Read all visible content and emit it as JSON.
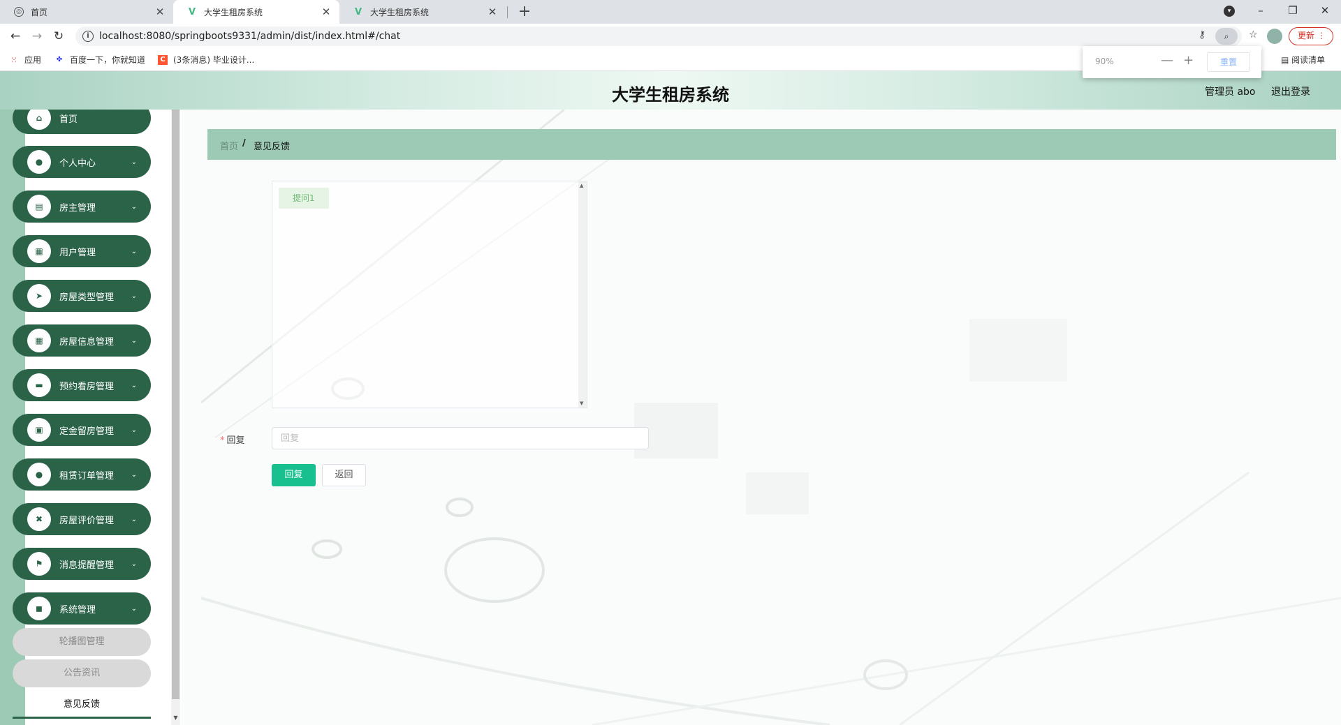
{
  "browser": {
    "tabs": [
      {
        "title": "首页"
      },
      {
        "title": "大学生租房系统"
      },
      {
        "title": "大学生租房系统"
      }
    ],
    "new_tab": "+",
    "url": "localhost:8080/springboots9331/admin/dist/index.html#/chat",
    "update_label": "更新",
    "window": {
      "minimize": "–",
      "restore": "❐",
      "close": "✕"
    },
    "bookmarks": [
      {
        "label": "应用"
      },
      {
        "label": "百度一下，你就知道"
      },
      {
        "label": "(3条消息) 毕业设计..."
      }
    ],
    "reading_list": "阅读清单",
    "zoom_popup": {
      "percent": "90%",
      "minus": "—",
      "plus": "+",
      "reset": "重置"
    }
  },
  "header": {
    "title": "大学生租房系统",
    "user": "管理员 abo",
    "logout": "退出登录"
  },
  "sidebar": {
    "items": [
      {
        "label": "首页",
        "icon": "home-icon",
        "glyph": "⌂",
        "expandable": false
      },
      {
        "label": "个人中心",
        "icon": "user-icon",
        "glyph": "●",
        "expandable": true
      },
      {
        "label": "房主管理",
        "icon": "clipboard-icon",
        "glyph": "▤",
        "expandable": true
      },
      {
        "label": "用户管理",
        "icon": "grid-icon",
        "glyph": "▦",
        "expandable": true
      },
      {
        "label": "房屋类型管理",
        "icon": "send-icon",
        "glyph": "➤",
        "expandable": true
      },
      {
        "label": "房屋信息管理",
        "icon": "grid-icon",
        "glyph": "▦",
        "expandable": true
      },
      {
        "label": "预约看房管理",
        "icon": "tag-icon",
        "glyph": "▬",
        "expandable": true
      },
      {
        "label": "定金留房管理",
        "icon": "briefcase-icon",
        "glyph": "▣",
        "expandable": true
      },
      {
        "label": "租赁订单管理",
        "icon": "user-icon",
        "glyph": "●",
        "expandable": true
      },
      {
        "label": "房屋评价管理",
        "icon": "ticket-icon",
        "glyph": "✖",
        "expandable": true
      },
      {
        "label": "消息提醒管理",
        "icon": "flag-icon",
        "glyph": "⚑",
        "expandable": true
      },
      {
        "label": "系统管理",
        "icon": "camera-icon",
        "glyph": "◼",
        "expandable": true
      }
    ],
    "chevron": "⌄",
    "sub_items": [
      {
        "label": "轮播图管理"
      },
      {
        "label": "公告资讯"
      }
    ],
    "active_sub": "意见反馈"
  },
  "breadcrumb": {
    "home": "首页",
    "separator": "/",
    "current": "意见反馈"
  },
  "chat": {
    "messages": [
      {
        "text": "提问1"
      }
    ]
  },
  "form": {
    "reply_label": "回复",
    "reply_required_mark": "*",
    "reply_value": "",
    "reply_placeholder": "回复",
    "submit_label": "回复",
    "back_label": "返回"
  },
  "colors": {
    "sidebar_menu": "#2b6349",
    "accent_band": "#9ccab5",
    "primary_button": "#18c08f"
  }
}
